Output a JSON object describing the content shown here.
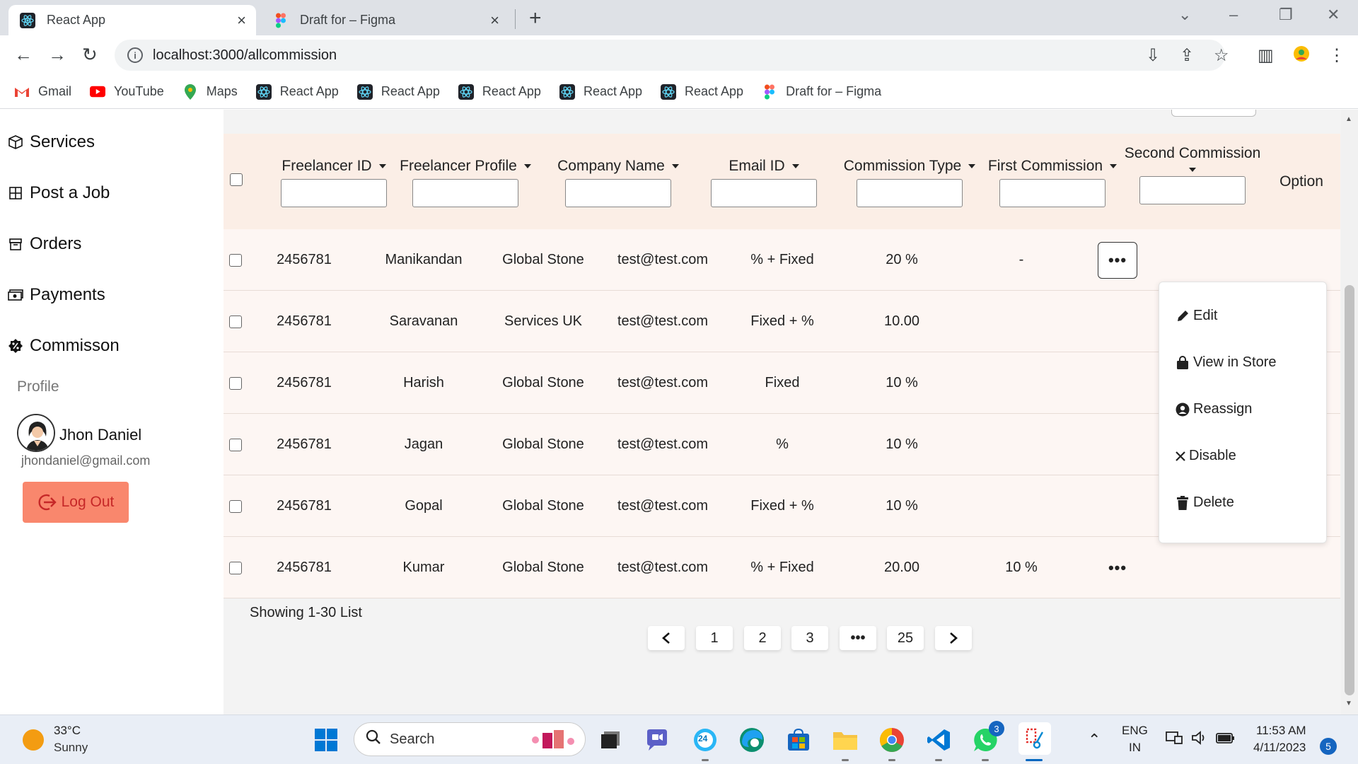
{
  "browser": {
    "tabs": [
      {
        "title": "React App",
        "icon": "react-icon",
        "active": true
      },
      {
        "title": "Draft for – Figma",
        "icon": "figma-icon",
        "active": false
      }
    ],
    "url": "localhost:3000/allcommission",
    "bookmarks": [
      {
        "label": "Gmail",
        "icon": "gmail-icon"
      },
      {
        "label": "YouTube",
        "icon": "youtube-icon"
      },
      {
        "label": "Maps",
        "icon": "maps-icon"
      },
      {
        "label": "React App",
        "icon": "react-icon"
      },
      {
        "label": "React App",
        "icon": "react-icon"
      },
      {
        "label": "React App",
        "icon": "react-icon"
      },
      {
        "label": "React App",
        "icon": "react-icon"
      },
      {
        "label": "React App",
        "icon": "react-icon"
      },
      {
        "label": "Draft for – Figma",
        "icon": "figma-icon"
      }
    ]
  },
  "sidebar": {
    "items": [
      {
        "label": "Services",
        "icon": "box-icon"
      },
      {
        "label": "Post a Job",
        "icon": "grid-icon"
      },
      {
        "label": "Orders",
        "icon": "archive-icon"
      },
      {
        "label": "Payments",
        "icon": "cash-icon"
      },
      {
        "label": "Commisson",
        "icon": "badge-percent-icon"
      }
    ],
    "profile_label": "Profile",
    "user_name": "Jhon Daniel",
    "user_email": "jhondaniel@gmail.com",
    "logout_label": "Log Out"
  },
  "table": {
    "columns": [
      "Freelancer ID",
      "Freelancer Profile",
      "Company Name",
      "Email ID",
      "Commission Type",
      "First Commission",
      "Second Commission",
      "Option"
    ],
    "rows": [
      [
        "2456781",
        "Manikandan",
        "Global Stone",
        "test@test.com",
        "% + Fixed",
        "20 %",
        "-"
      ],
      [
        "2456781",
        "Saravanan",
        "Services UK",
        "test@test.com",
        "Fixed + %",
        "10.00",
        ""
      ],
      [
        "2456781",
        "Harish",
        "Global Stone",
        "test@test.com",
        "Fixed",
        "10 %",
        ""
      ],
      [
        "2456781",
        "Jagan",
        "Global Stone",
        "test@test.com",
        "%",
        "10 %",
        ""
      ],
      [
        "2456781",
        "Gopal",
        "Global Stone",
        "test@test.com",
        "Fixed + %",
        "10 %",
        ""
      ],
      [
        "2456781",
        "Kumar",
        "Global Stone",
        "test@test.com",
        "% + Fixed",
        "20.00",
        "10 %"
      ]
    ],
    "option_glyph": "•••"
  },
  "dropdown": {
    "items": [
      {
        "label": "Edit",
        "icon": "pencil-icon"
      },
      {
        "label": "View in Store",
        "icon": "bag-icon"
      },
      {
        "label": "Reassign",
        "icon": "user-circle-icon"
      },
      {
        "label": "Disable",
        "icon": "x-icon"
      },
      {
        "label": "Delete",
        "icon": "trash-icon"
      }
    ]
  },
  "pagination": {
    "showing": "Showing 1-30 List",
    "pages": [
      "1",
      "2",
      "3",
      "•••",
      "25"
    ],
    "prev": "‹",
    "next": "›"
  },
  "taskbar": {
    "temperature": "33°C",
    "condition": "Sunny",
    "search_placeholder": "Search",
    "language_top": "ENG",
    "language_bottom": "IN",
    "time": "11:53 AM",
    "date": "4/11/2023",
    "notification_count": "5",
    "whatsapp_badge": "3",
    "calendar_day": "24"
  },
  "colors": {
    "header_bg": "#fbeee6",
    "row_bg": "#fdf6f3",
    "logout_bg": "#f9876d",
    "logout_text": "#c62828"
  }
}
